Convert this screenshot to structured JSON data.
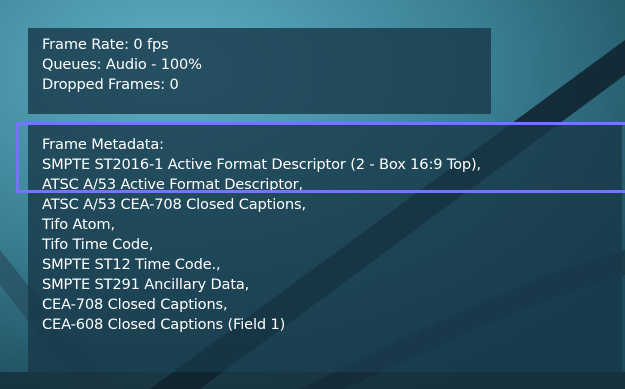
{
  "stats": {
    "frame_rate": "Frame Rate: 0 fps",
    "queues": "Queues: Audio - 100%",
    "dropped_frames": "Dropped Frames: 0"
  },
  "metadata": {
    "heading": "Frame Metadata:",
    "items": [
      "SMPTE ST2016-1 Active Format Descriptor (2 - Box 16:9 Top),",
      "ATSC A/53 Active Format Descriptor,",
      "ATSC A/53 CEA-708 Closed Captions,",
      "Tifo Atom,",
      "Tifo Time Code,",
      "SMPTE ST12 Time Code.,",
      "SMPTE ST291 Ancillary Data,",
      "CEA-708 Closed Captions,",
      "CEA-608 Closed Captions (Field 1)"
    ]
  },
  "colors": {
    "video_background": "#3e8599",
    "overlay": "#183848",
    "highlight_border": "#7573ff",
    "text": "#ffffff"
  }
}
